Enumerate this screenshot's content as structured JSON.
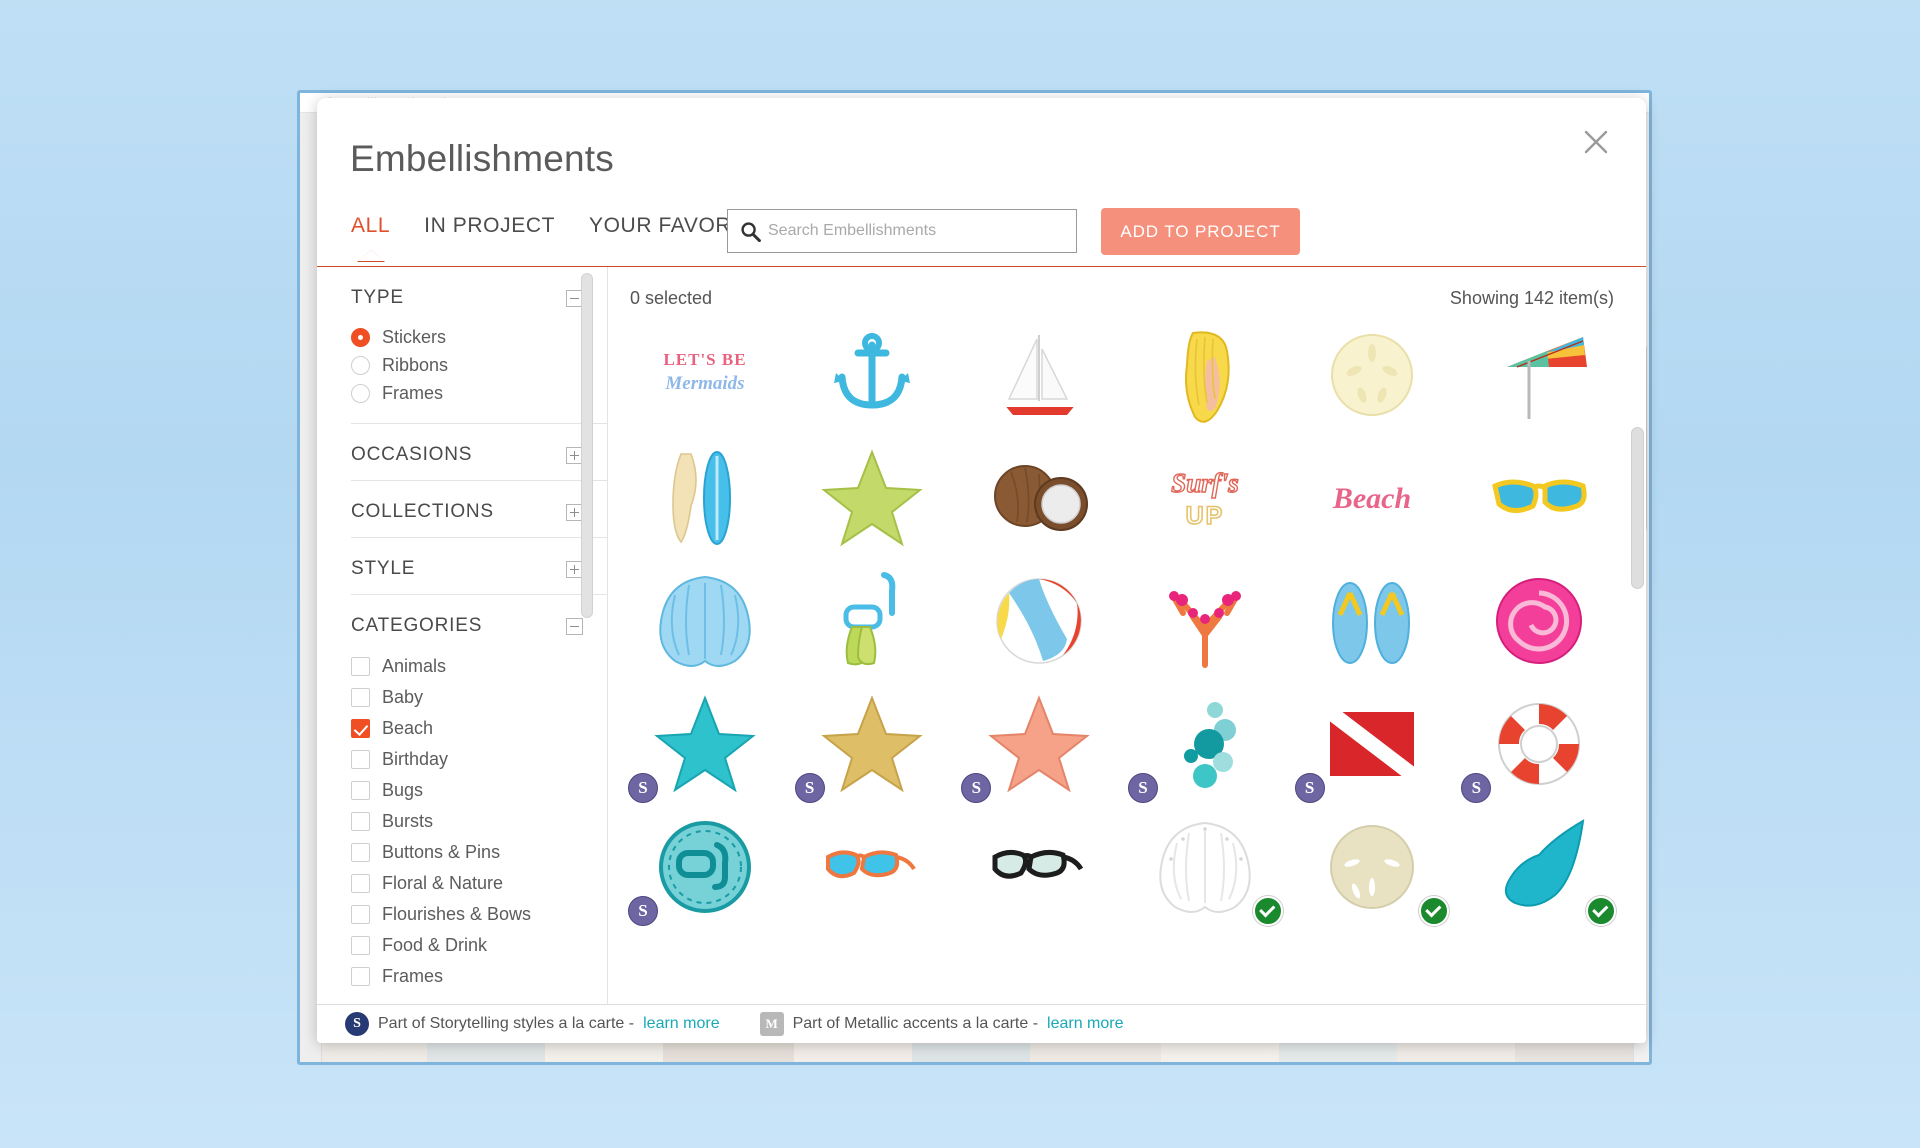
{
  "background_window": {
    "ghost_text": "Storytelling styles a la carte"
  },
  "dialog": {
    "title": "Embellishments",
    "close_icon": "close-icon"
  },
  "tabs": [
    {
      "label": "ALL",
      "active": true
    },
    {
      "label": "IN PROJECT",
      "active": false
    },
    {
      "label": "YOUR FAVORITES",
      "active": false
    }
  ],
  "search": {
    "placeholder": "Search Embellishments",
    "value": "",
    "icon": "search-icon"
  },
  "primary_action": {
    "label": "ADD TO PROJECT",
    "color": "#f4907c"
  },
  "sidebar": {
    "facets": [
      {
        "title": "TYPE",
        "expanded": true,
        "control": "minus",
        "input_type": "radio",
        "options": [
          {
            "label": "Stickers",
            "checked": true
          },
          {
            "label": "Ribbons",
            "checked": false
          },
          {
            "label": "Frames",
            "checked": false
          }
        ]
      },
      {
        "title": "OCCASIONS",
        "expanded": false,
        "control": "plus",
        "options": []
      },
      {
        "title": "COLLECTIONS",
        "expanded": false,
        "control": "plus",
        "options": []
      },
      {
        "title": "STYLE",
        "expanded": false,
        "control": "plus",
        "options": []
      },
      {
        "title": "CATEGORIES",
        "expanded": true,
        "control": "minus",
        "input_type": "checkbox",
        "options": [
          {
            "label": "Animals",
            "checked": false
          },
          {
            "label": "Baby",
            "checked": false
          },
          {
            "label": "Beach",
            "checked": true
          },
          {
            "label": "Birthday",
            "checked": false
          },
          {
            "label": "Bugs",
            "checked": false
          },
          {
            "label": "Bursts",
            "checked": false
          },
          {
            "label": "Buttons & Pins",
            "checked": false
          },
          {
            "label": "Floral & Nature",
            "checked": false
          },
          {
            "label": "Flourishes & Bows",
            "checked": false
          },
          {
            "label": "Food & Drink",
            "checked": false
          },
          {
            "label": "Frames",
            "checked": false
          }
        ]
      }
    ],
    "accent_color": "#f04e23"
  },
  "content": {
    "selected_count_label": "0 selected",
    "showing_label": "Showing 142 item(s)",
    "items": [
      {
        "name": "lets-be-mermaids-word-art",
        "badge": null
      },
      {
        "name": "anchor",
        "badge": null
      },
      {
        "name": "sailboat",
        "badge": null
      },
      {
        "name": "yellow-shell",
        "badge": null
      },
      {
        "name": "sand-dollar",
        "badge": null
      },
      {
        "name": "beach-umbrella",
        "badge": null
      },
      {
        "name": "surfboards",
        "badge": null
      },
      {
        "name": "green-starfish",
        "badge": null
      },
      {
        "name": "coconuts",
        "badge": null
      },
      {
        "name": "surfs-up-word-art",
        "badge": null
      },
      {
        "name": "beach-word-art",
        "badge": null
      },
      {
        "name": "yellow-sunglasses",
        "badge": null
      },
      {
        "name": "blue-scallop-shell",
        "badge": null
      },
      {
        "name": "snorkel-and-fins",
        "badge": null
      },
      {
        "name": "beach-ball",
        "badge": null
      },
      {
        "name": "pink-coral",
        "badge": null
      },
      {
        "name": "flip-flops",
        "badge": null
      },
      {
        "name": "pink-conch-shell",
        "badge": null
      },
      {
        "name": "teal-starfish",
        "badge": "S"
      },
      {
        "name": "gold-glitter-starfish",
        "badge": "S"
      },
      {
        "name": "coral-starfish",
        "badge": "S"
      },
      {
        "name": "teal-bubbles",
        "badge": "S"
      },
      {
        "name": "dive-flag",
        "badge": "S"
      },
      {
        "name": "life-ring",
        "badge": "S"
      },
      {
        "name": "snorkel-mask-badge",
        "badge": "S"
      },
      {
        "name": "orange-sunglasses",
        "badge": null
      },
      {
        "name": "black-sunglasses",
        "badge": null
      },
      {
        "name": "white-scallop-shell",
        "badge": "owned"
      },
      {
        "name": "cream-sand-dollar",
        "badge": "owned"
      },
      {
        "name": "teal-conch-shell",
        "badge": "owned"
      }
    ]
  },
  "footer": {
    "legends": [
      {
        "badge": "S",
        "text": "Part of Storytelling styles a la carte  -",
        "link": "learn more"
      },
      {
        "badge": "M",
        "text": "Part of Metallic accents a la carte  -",
        "link": "learn more"
      }
    ],
    "link_color": "#18a8b8"
  }
}
